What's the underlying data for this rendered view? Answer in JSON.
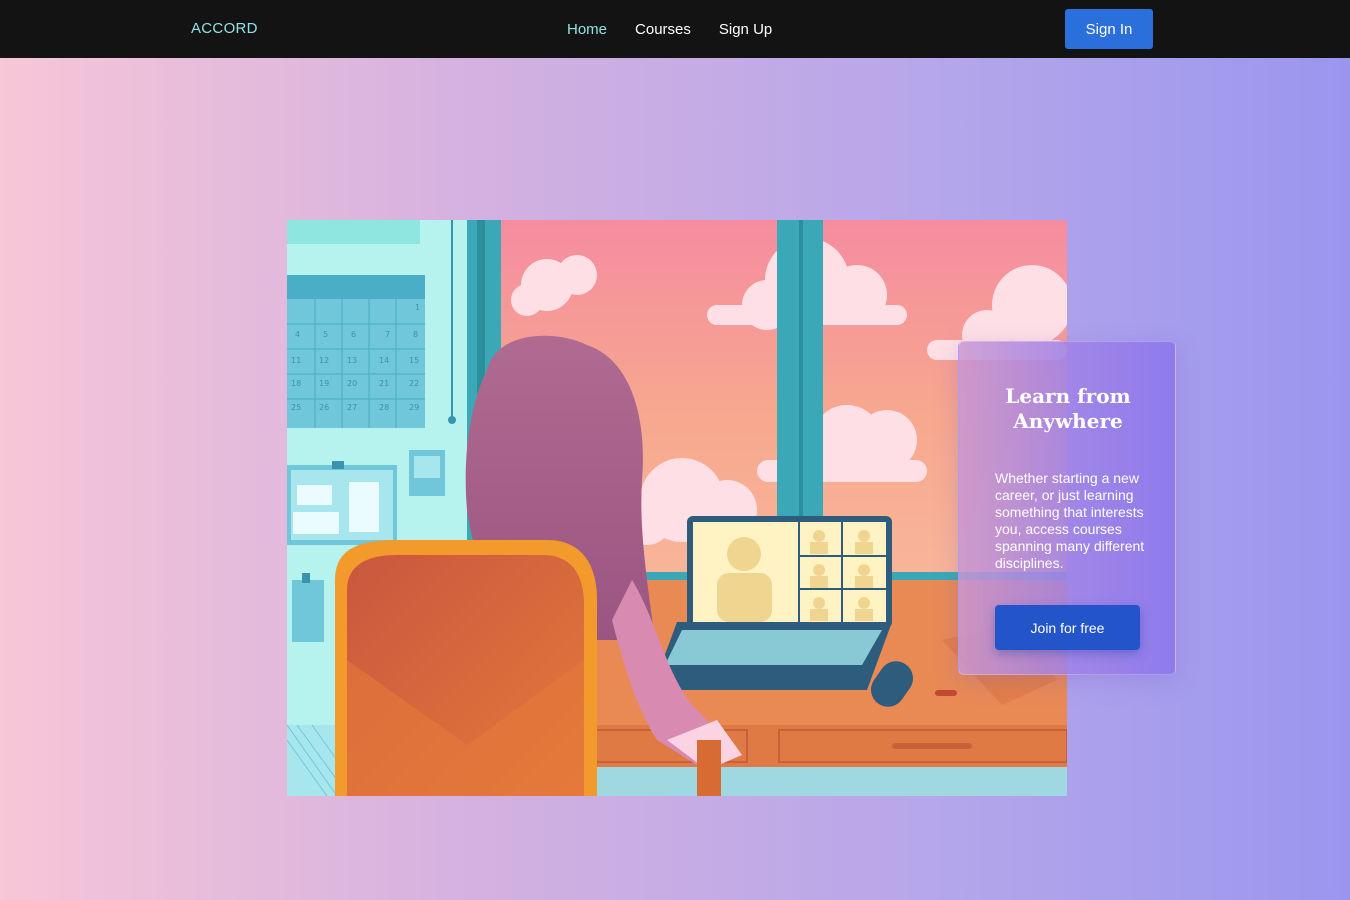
{
  "header": {
    "brand": "ACCORD",
    "nav": [
      {
        "label": "Home",
        "active": true
      },
      {
        "label": "Courses",
        "active": false
      },
      {
        "label": "Sign Up",
        "active": false
      }
    ],
    "sign_in_label": "Sign In"
  },
  "hero": {
    "title": "Learn from Anywhere",
    "description": "Whether starting a new career, or just learning something that interests you, access courses spanning many different disciplines.",
    "cta_label": "Join for free"
  },
  "illustration": {
    "calendar_numbers": [
      "1",
      "4",
      "5",
      "6",
      "7",
      "8",
      "11",
      "12",
      "13",
      "14",
      "15",
      "18",
      "19",
      "20",
      "21",
      "22",
      "25",
      "26",
      "27",
      "28",
      "29"
    ]
  },
  "colors": {
    "nav_background": "#131313",
    "brand_accent": "#8fe3e7",
    "primary_button": "#2a6fdc",
    "cta_button": "#2454c9"
  }
}
